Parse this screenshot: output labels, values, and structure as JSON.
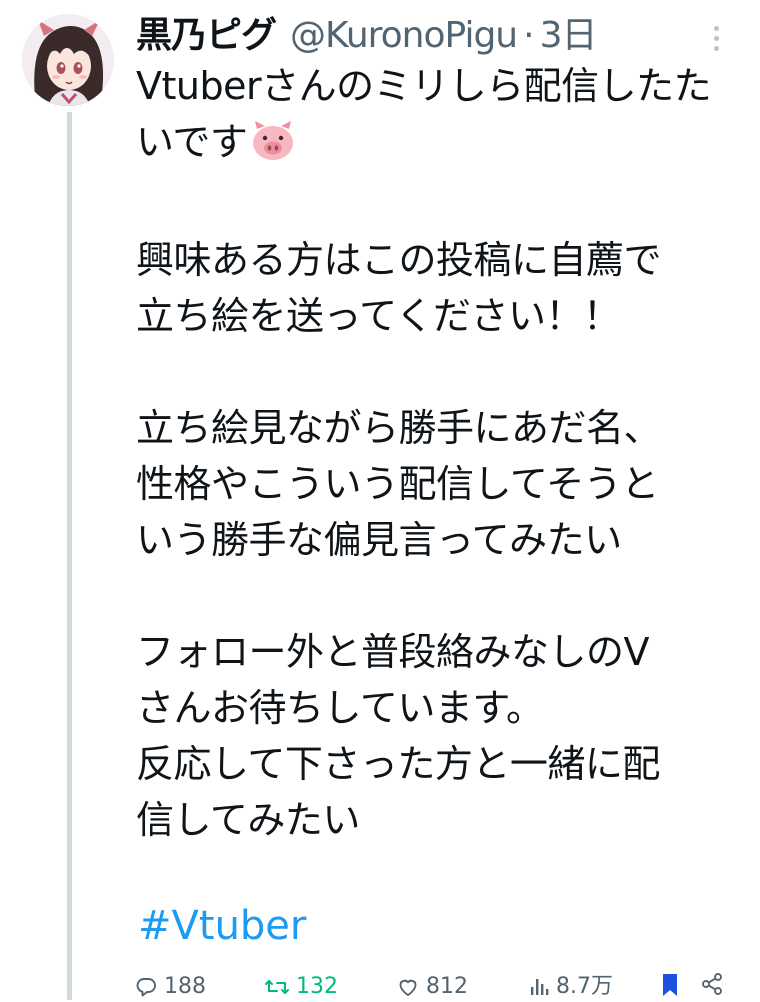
{
  "tweet": {
    "display_name": "黒乃ピグ",
    "handle": "@KuronoPigu",
    "separator": "·",
    "time": "3日",
    "body_lines": [
      "Vtuberさんのミリしら配信したた",
      "いです",
      "",
      "興味ある方はこの投稿に自薦で",
      "立ち絵を送ってください！！",
      "",
      "立ち絵見ながら勝手にあだ名、",
      "性格やこういう配信してそうと",
      "いう勝手な偏見言ってみたい",
      "",
      "フォロー外と普段絡みなしのV",
      "さんお待ちしています。",
      "反応して下さった方と一緒に配",
      "信してみたい"
    ],
    "hashtag": "#Vtuber",
    "stats": {
      "replies": "188",
      "retweets": "132",
      "likes": "812",
      "views": "8.7万"
    }
  },
  "icons": {
    "avatar": "profile-avatar-anime-girl",
    "more": "vertical-ellipsis-icon",
    "emoji": "pig-face-emoji",
    "reply": "comment-bubble-icon",
    "retweet": "retweet-arrows-icon",
    "like": "heart-icon",
    "views": "bar-chart-icon",
    "bookmark": "bookmark-icon",
    "share": "share-icon"
  },
  "colors": {
    "text": "#0f1419",
    "secondary": "#536471",
    "link": "#1d9bf0",
    "retweet": "#00ba7c",
    "bookmark": "#1d4fe0",
    "thread_line": "#cfd9de"
  }
}
